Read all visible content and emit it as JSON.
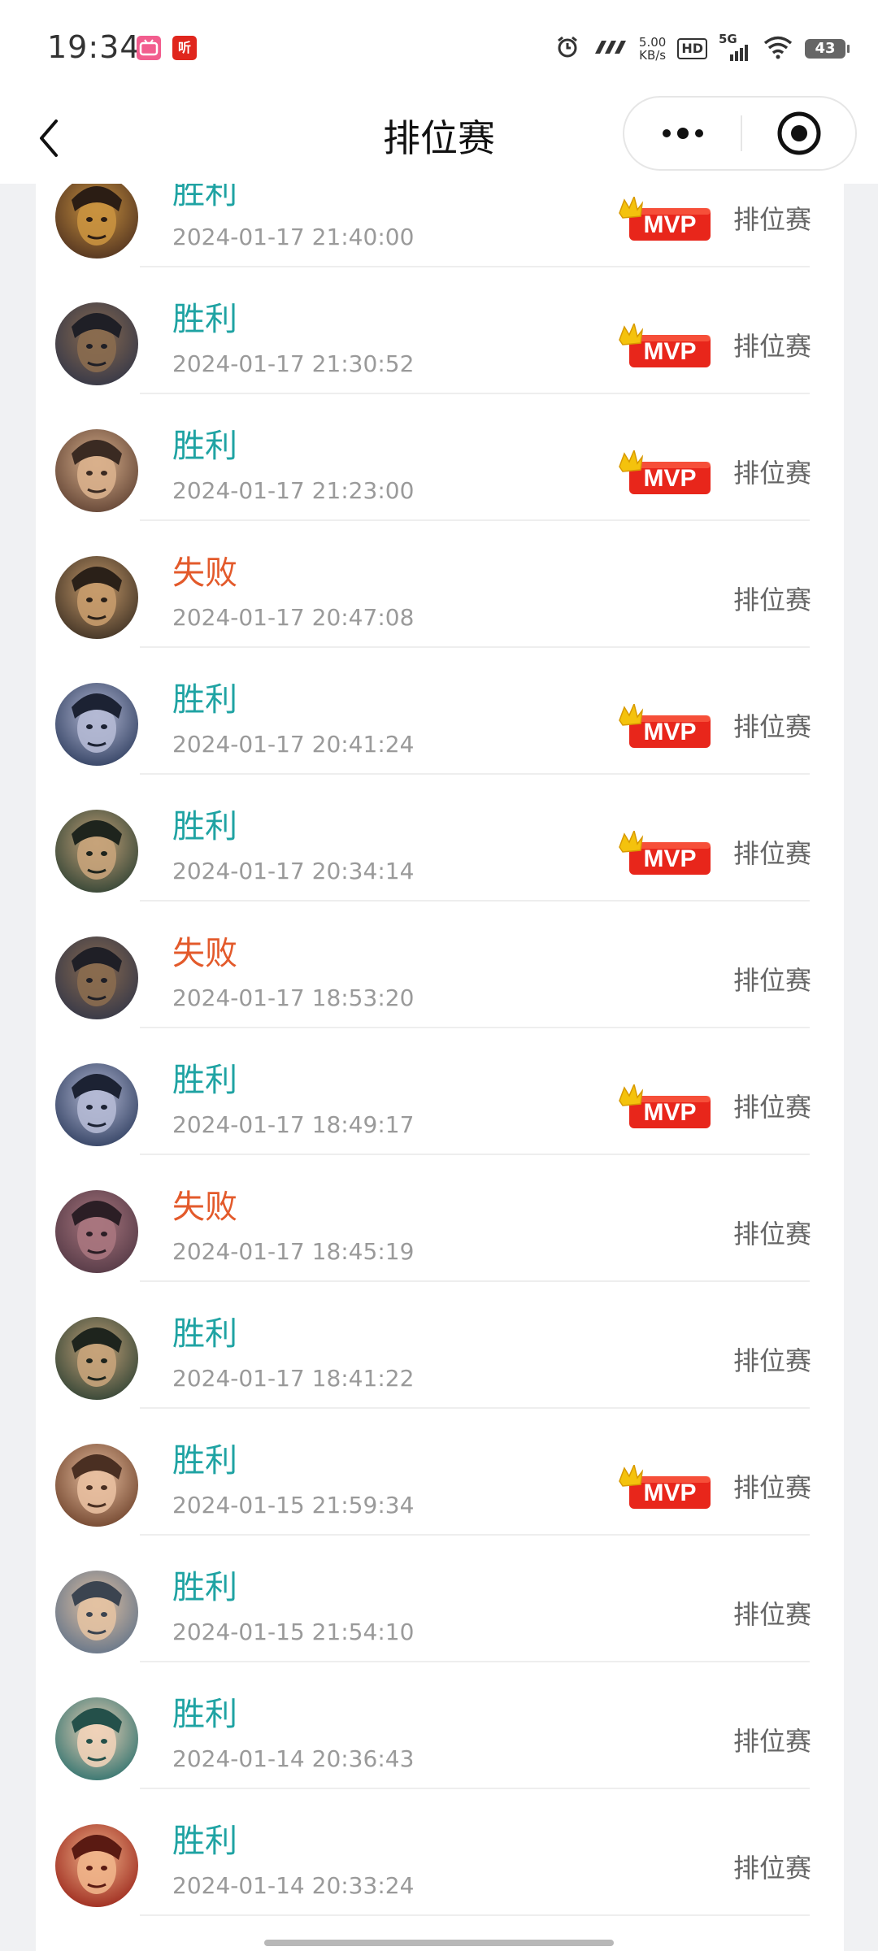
{
  "status_bar": {
    "time": "19:34",
    "app_badges": [
      "bili",
      "听"
    ],
    "net_speed_value": "5.00",
    "net_speed_unit": "KB/s",
    "hd_label": "HD",
    "signal_label": "5G",
    "battery": "43"
  },
  "nav": {
    "title": "排位赛"
  },
  "colors": {
    "win": "#1fa3a3",
    "lose": "#e35a2b",
    "mvp_red": "#e8261b",
    "crown": "#f4c20d"
  },
  "matches": [
    {
      "result": "胜利",
      "outcome": "win",
      "time": "2024-01-17 21:40:00",
      "mvp": true,
      "mode": "排位赛"
    },
    {
      "result": "胜利",
      "outcome": "win",
      "time": "2024-01-17 21:30:52",
      "mvp": true,
      "mode": "排位赛"
    },
    {
      "result": "胜利",
      "outcome": "win",
      "time": "2024-01-17 21:23:00",
      "mvp": true,
      "mode": "排位赛"
    },
    {
      "result": "失败",
      "outcome": "lose",
      "time": "2024-01-17 20:47:08",
      "mvp": false,
      "mode": "排位赛"
    },
    {
      "result": "胜利",
      "outcome": "win",
      "time": "2024-01-17 20:41:24",
      "mvp": true,
      "mode": "排位赛"
    },
    {
      "result": "胜利",
      "outcome": "win",
      "time": "2024-01-17 20:34:14",
      "mvp": true,
      "mode": "排位赛"
    },
    {
      "result": "失败",
      "outcome": "lose",
      "time": "2024-01-17 18:53:20",
      "mvp": false,
      "mode": "排位赛"
    },
    {
      "result": "胜利",
      "outcome": "win",
      "time": "2024-01-17 18:49:17",
      "mvp": true,
      "mode": "排位赛"
    },
    {
      "result": "失败",
      "outcome": "lose",
      "time": "2024-01-17 18:45:19",
      "mvp": false,
      "mode": "排位赛"
    },
    {
      "result": "胜利",
      "outcome": "win",
      "time": "2024-01-17 18:41:22",
      "mvp": false,
      "mode": "排位赛"
    },
    {
      "result": "胜利",
      "outcome": "win",
      "time": "2024-01-15 21:59:34",
      "mvp": true,
      "mode": "排位赛"
    },
    {
      "result": "胜利",
      "outcome": "win",
      "time": "2024-01-15 21:54:10",
      "mvp": false,
      "mode": "排位赛"
    },
    {
      "result": "胜利",
      "outcome": "win",
      "time": "2024-01-14 20:36:43",
      "mvp": false,
      "mode": "排位赛"
    },
    {
      "result": "胜利",
      "outcome": "win",
      "time": "2024-01-14 20:33:24",
      "mvp": false,
      "mode": "排位赛"
    }
  ],
  "mvp_label": "MVP"
}
